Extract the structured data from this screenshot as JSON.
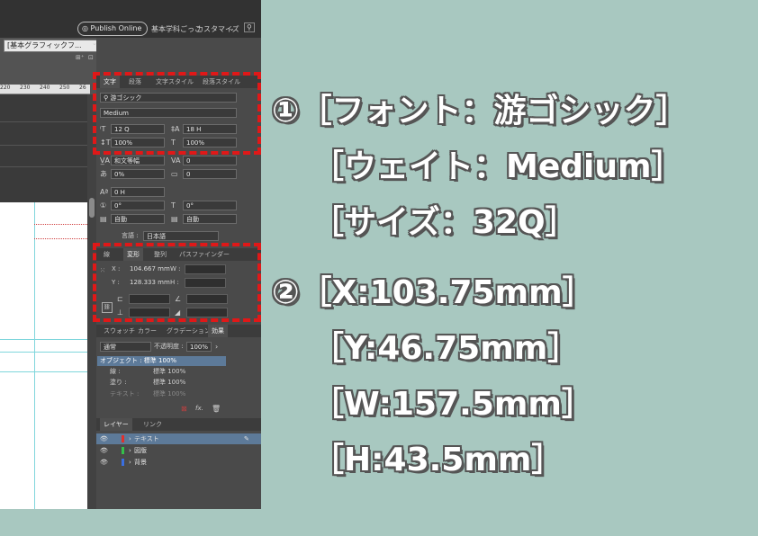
{
  "topbar": {
    "publish_label": "Publish Online",
    "workspace_label": "基本学科ごっこ",
    "customize_label": "カスタマイズ",
    "paragraph_style": "[基本グラフィックフ..."
  },
  "ruler": {
    "ticks": [
      "220",
      "230",
      "240",
      "250",
      "26"
    ]
  },
  "char_panel": {
    "tabs": [
      "文字",
      "段落",
      "文字スタイル",
      "段落スタイル"
    ],
    "font_family": "游ゴシック",
    "font_style": "Medium",
    "size": "12 Q",
    "leading": "18 H",
    "vscale": "100%",
    "hscale": "100%",
    "mojikumi": "和文等幅",
    "kerning": "0",
    "tsume": "0%",
    "tracking": "0",
    "baseline": "0 H",
    "rotate": "0°",
    "skew": "0°",
    "aki_before": "自動",
    "aki_after": "自動",
    "language_label": "言語 :",
    "language": "日本語"
  },
  "transform_panel": {
    "tabs": [
      "線",
      "変形",
      "整列",
      "パスファインダー"
    ],
    "x_label": "X :",
    "x_value": "104.667 mm",
    "w_label": "W :",
    "y_label": "Y :",
    "y_value": "128.333 mm",
    "h_label": "H :"
  },
  "effects_panel": {
    "tabs": [
      "スウォッチ",
      "カラー",
      "グラデーション",
      "効果"
    ],
    "blend_mode": "通常",
    "opacity_label": "不透明度 :",
    "opacity_value": "100%",
    "object_row": "オブジェクト : 標準 100%",
    "rows": [
      {
        "label": "線 :",
        "value": "標準 100%"
      },
      {
        "label": "塗り :",
        "value": "標準 100%"
      },
      {
        "label": "テキスト :",
        "value": "標準 100%"
      }
    ],
    "fx_label": "fx."
  },
  "layers_panel": {
    "tabs": [
      "レイヤー",
      "リンク"
    ],
    "layers": [
      {
        "name": "テキスト",
        "color": "#e0302c"
      },
      {
        "name": "図版",
        "color": "#35c04a"
      },
      {
        "name": "背景",
        "color": "#3a6fe0"
      }
    ]
  },
  "annotations": {
    "font_name": "①［フォント：游ゴシック］",
    "weight": "［ウェイト：Medium］",
    "size": "［サイズ：32Q］",
    "x": "②［X:103.75mm］",
    "y": "［Y:46.75mm］",
    "w": "［W:157.5mm］",
    "h": "［H:43.5mm］"
  },
  "colors": {
    "background": "#a8c8c0",
    "highlight": "#e01818",
    "annotation_text": "#ffffff"
  }
}
